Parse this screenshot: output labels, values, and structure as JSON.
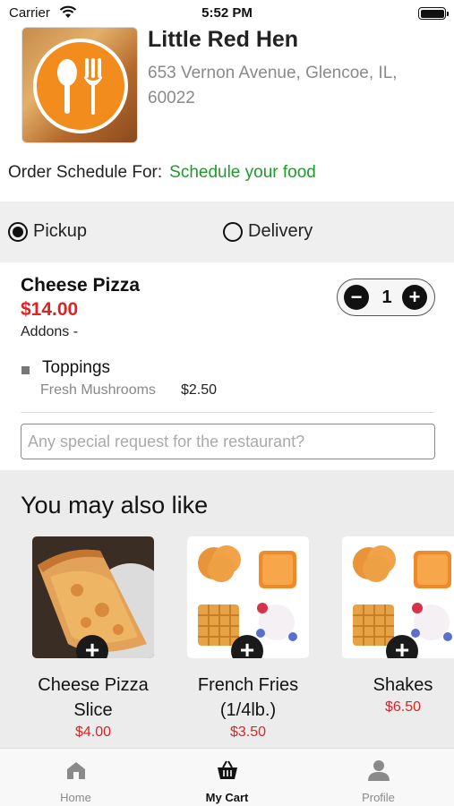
{
  "status_bar": {
    "carrier": "Carrier",
    "time": "5:52 PM"
  },
  "restaurant": {
    "name": "Little Red Hen",
    "address": "653 Vernon Avenue, Glencoe, IL, 60022"
  },
  "schedule": {
    "label": "Order Schedule For:",
    "link": "Schedule your food"
  },
  "order_mode": {
    "pickup_label": "Pickup",
    "delivery_label": "Delivery",
    "selected": "pickup"
  },
  "cart_item": {
    "name": "Cheese Pizza",
    "price": "$14.00",
    "addons_label": "Addons -",
    "quantity": "1",
    "addon_group": "Toppings",
    "addon_name": "Fresh Mushrooms",
    "addon_price": "$2.50"
  },
  "special_request": {
    "placeholder": "Any special request for the restaurant?",
    "value": ""
  },
  "recommendations": {
    "title": "You may also like",
    "items": [
      {
        "name": "Cheese Pizza Slice",
        "price": "$4.00"
      },
      {
        "name": "French Fries (1/4lb.)",
        "price": "$3.50"
      },
      {
        "name": "Shakes",
        "price": "$6.50"
      }
    ]
  },
  "tabs": [
    {
      "label": "Home",
      "icon": "home-icon",
      "active": false
    },
    {
      "label": "My Cart",
      "icon": "basket-icon",
      "active": true
    },
    {
      "label": "Profile",
      "icon": "person-icon",
      "active": false
    }
  ],
  "colors": {
    "price_red": "#e02222",
    "link_green": "#1e9b2a",
    "logo_orange": "#f28c1c"
  }
}
